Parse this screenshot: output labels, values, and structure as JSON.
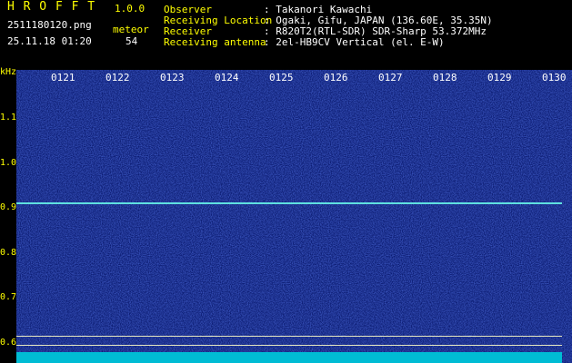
{
  "app": {
    "name": "H R O F F T",
    "version": "1.0.0",
    "filename": "2511180120.png",
    "datetime": "25.11.18 01:20",
    "mode_label": "meteor",
    "count": "54"
  },
  "station": {
    "observer_label": "Observer",
    "observer_value": ": Takanori Kawachi",
    "location_label": "Receiving Location",
    "location_value": ": Ogaki, Gifu, JAPAN (136.60E, 35.35N)",
    "receiver_label": "Receiver",
    "receiver_value": ": R820T2(RTL-SDR) SDR-Sharp 53.372MHz",
    "antenna_label": "Receiving antenna",
    "antenna_value": ": 2el-HB9CV Vertical (el. E-W)"
  },
  "axis": {
    "y_unit": "kHz",
    "y_ticks": [
      "1.1",
      "1.0",
      "0.9",
      "0.8",
      "0.7",
      "0.6"
    ],
    "x_ticks": [
      "0121",
      "0122",
      "0123",
      "0124",
      "0125",
      "0126",
      "0127",
      "0128",
      "0129",
      "0130"
    ]
  },
  "colors": {
    "background": "#000000",
    "spectrogram": "#0a1a70",
    "signal": "#5fe0e0",
    "label_yellow": "#ffff00",
    "label_white": "#ffffff"
  }
}
